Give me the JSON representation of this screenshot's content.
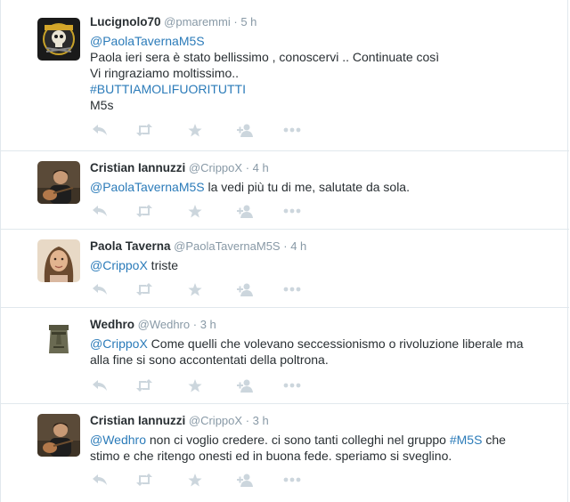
{
  "icon_color": "#ccd6dd",
  "link_color": "#2b7bb9",
  "tweets": [
    {
      "name": "Lucignolo70",
      "handle": "@pmaremmi",
      "separator": "·",
      "time": "5 h",
      "avatar": "gnr-logo-avatar",
      "lines": [
        {
          "mention": "@PaolaTavernaM5S",
          "text": ""
        },
        {
          "mention": "",
          "text": "Paola ieri sera è stato bellissimo , conoscervi .. Continuate così"
        },
        {
          "mention": "",
          "text": "Vi ringraziamo moltissimo.."
        },
        {
          "mention": "#BUTTIAMOLIFUORITUTTI",
          "text": ""
        },
        {
          "mention": "",
          "text": "M5s"
        }
      ]
    },
    {
      "name": "Cristian Iannuzzi",
      "handle": "@CrippoX",
      "separator": "·",
      "time": "4 h",
      "avatar": "man-with-guitar-avatar",
      "lines": [
        {
          "mention": "@PaolaTavernaM5S",
          "text": " la vedi più tu di me, salutate da sola."
        }
      ]
    },
    {
      "name": "Paola Taverna",
      "handle": "@PaolaTavernaM5S",
      "separator": "·",
      "time": "4 h",
      "avatar": "woman-portrait-avatar",
      "lines": [
        {
          "mention": "@CrippoX",
          "text": " triste"
        }
      ]
    },
    {
      "name": "Wedhro",
      "handle": "@Wedhro",
      "separator": "·",
      "time": "3 h",
      "avatar": "moai-statue-avatar",
      "lines": [
        {
          "mention": "@CrippoX",
          "text": " Come quelli che volevano seccessionismo o rivoluzione liberale ma"
        },
        {
          "mention": "",
          "text": "alla fine si sono accontentati della poltrona."
        }
      ]
    },
    {
      "name": "Cristian Iannuzzi",
      "handle": "@CrippoX",
      "separator": "·",
      "time": "3 h",
      "avatar": "man-with-guitar-avatar",
      "lines": [
        {
          "mention": "@Wedhro",
          "text": " non ci voglio credere. ci sono tanti colleghi nel gruppo ",
          "tag": "#M5S",
          "tail": " che"
        },
        {
          "mention": "",
          "text": "stimo e che ritengo onesti ed in buona fede. speriamo si sveglino."
        }
      ]
    }
  ],
  "actions": [
    "reply-icon",
    "retweet-icon",
    "favorite-icon",
    "follow-icon",
    "more-icon"
  ]
}
